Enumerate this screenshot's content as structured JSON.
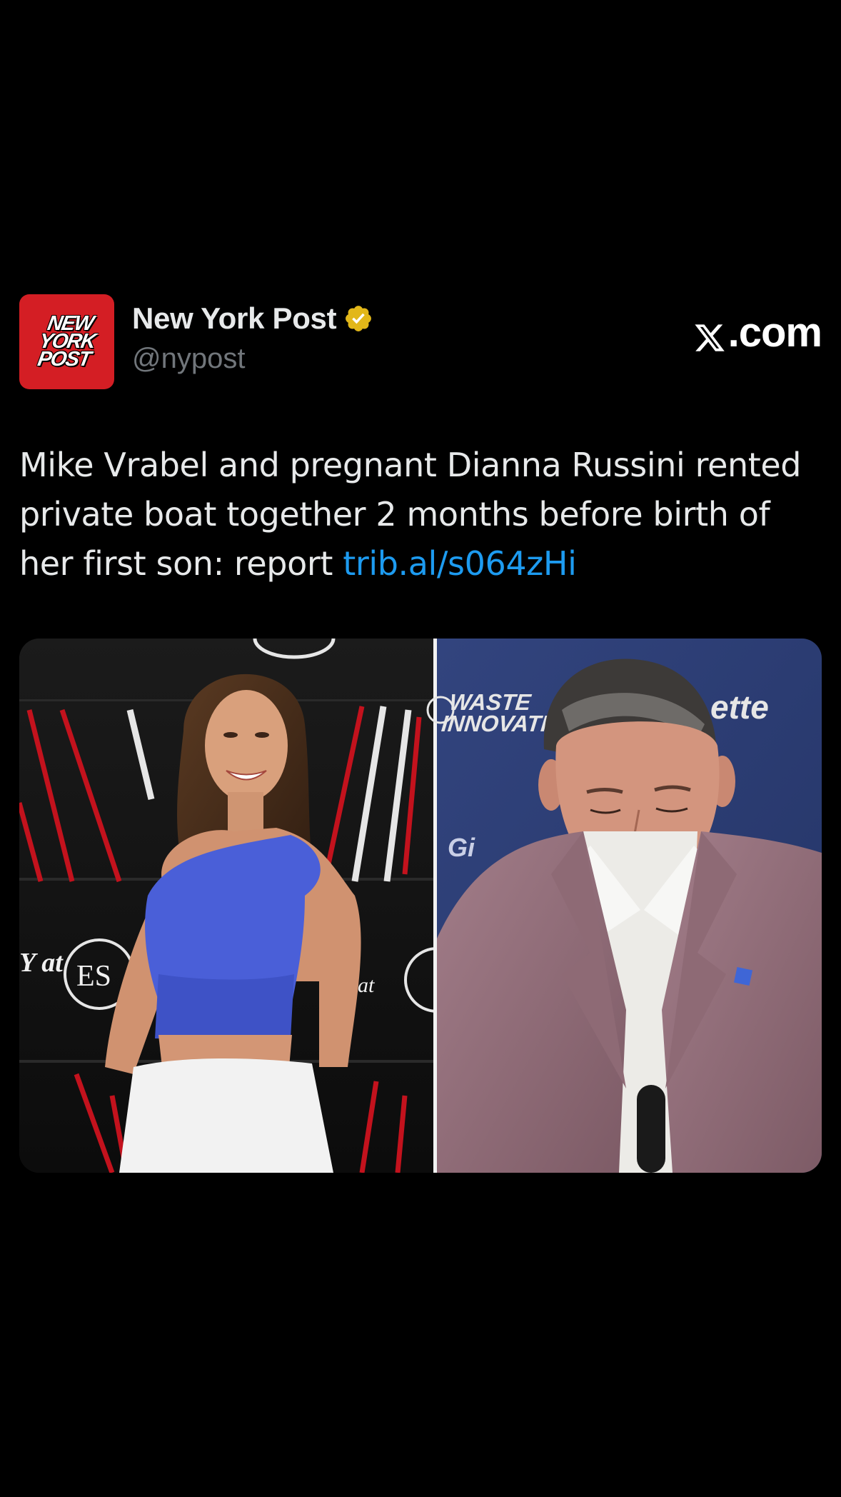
{
  "tweet": {
    "author": {
      "display_name": "New York Post",
      "handle": "@nypost",
      "verified": true,
      "avatar_lines": [
        "NEW",
        "YORK",
        "POST"
      ],
      "avatar_color": "#d41e24"
    },
    "brand": {
      "icon": "x-logo-icon",
      "suffix": ".com"
    },
    "text_body": "Mike Vrabel and pregnant Dianna Russini rented private boat together 2 months before birth of her first son: report ",
    "link_text": "trib.al/s064zHi",
    "media": {
      "left_photo": {
        "backdrop_lettering": [
          "Y at",
          "ES"
        ]
      },
      "right_photo": {
        "backdrop_lettering": [
          "WASTE",
          "INNOVATIO",
          "ette",
          "at"
        ]
      }
    }
  },
  "colors": {
    "background": "#000000",
    "text": "#e7e9ea",
    "secondary_text": "#71767b",
    "link": "#1d9bf0",
    "verified_gold": "#e2b719"
  }
}
